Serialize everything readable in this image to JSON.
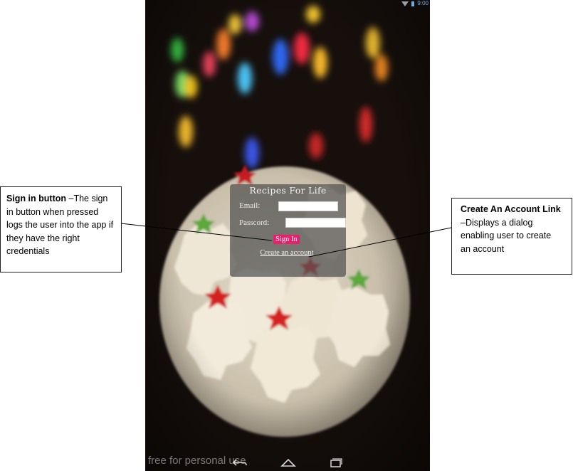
{
  "status_bar": {
    "time": "9:00"
  },
  "app": {
    "title": "Recipes For Life",
    "email_label": "Email:",
    "email_value": "",
    "password_label": "Passcord:",
    "password_value": "",
    "signin_label": "Sign In",
    "create_account_label": "Create an account"
  },
  "watermark": "free for personal use",
  "annotations": {
    "signin": {
      "heading": "Sign in button",
      "body": " –The sign in button when pressed logs the user into the app if they have the right credentials"
    },
    "create": {
      "heading": "Create An Account Link",
      "body": " –Displays a dialog enabling user to create an account"
    }
  },
  "colors": {
    "signin_button": "#ea1f6c",
    "card_background": "#505050",
    "status_icons": "#6ab0e6"
  },
  "icons": [
    "wifi-icon",
    "battery-icon",
    "back-icon",
    "home-icon",
    "recents-icon"
  ]
}
